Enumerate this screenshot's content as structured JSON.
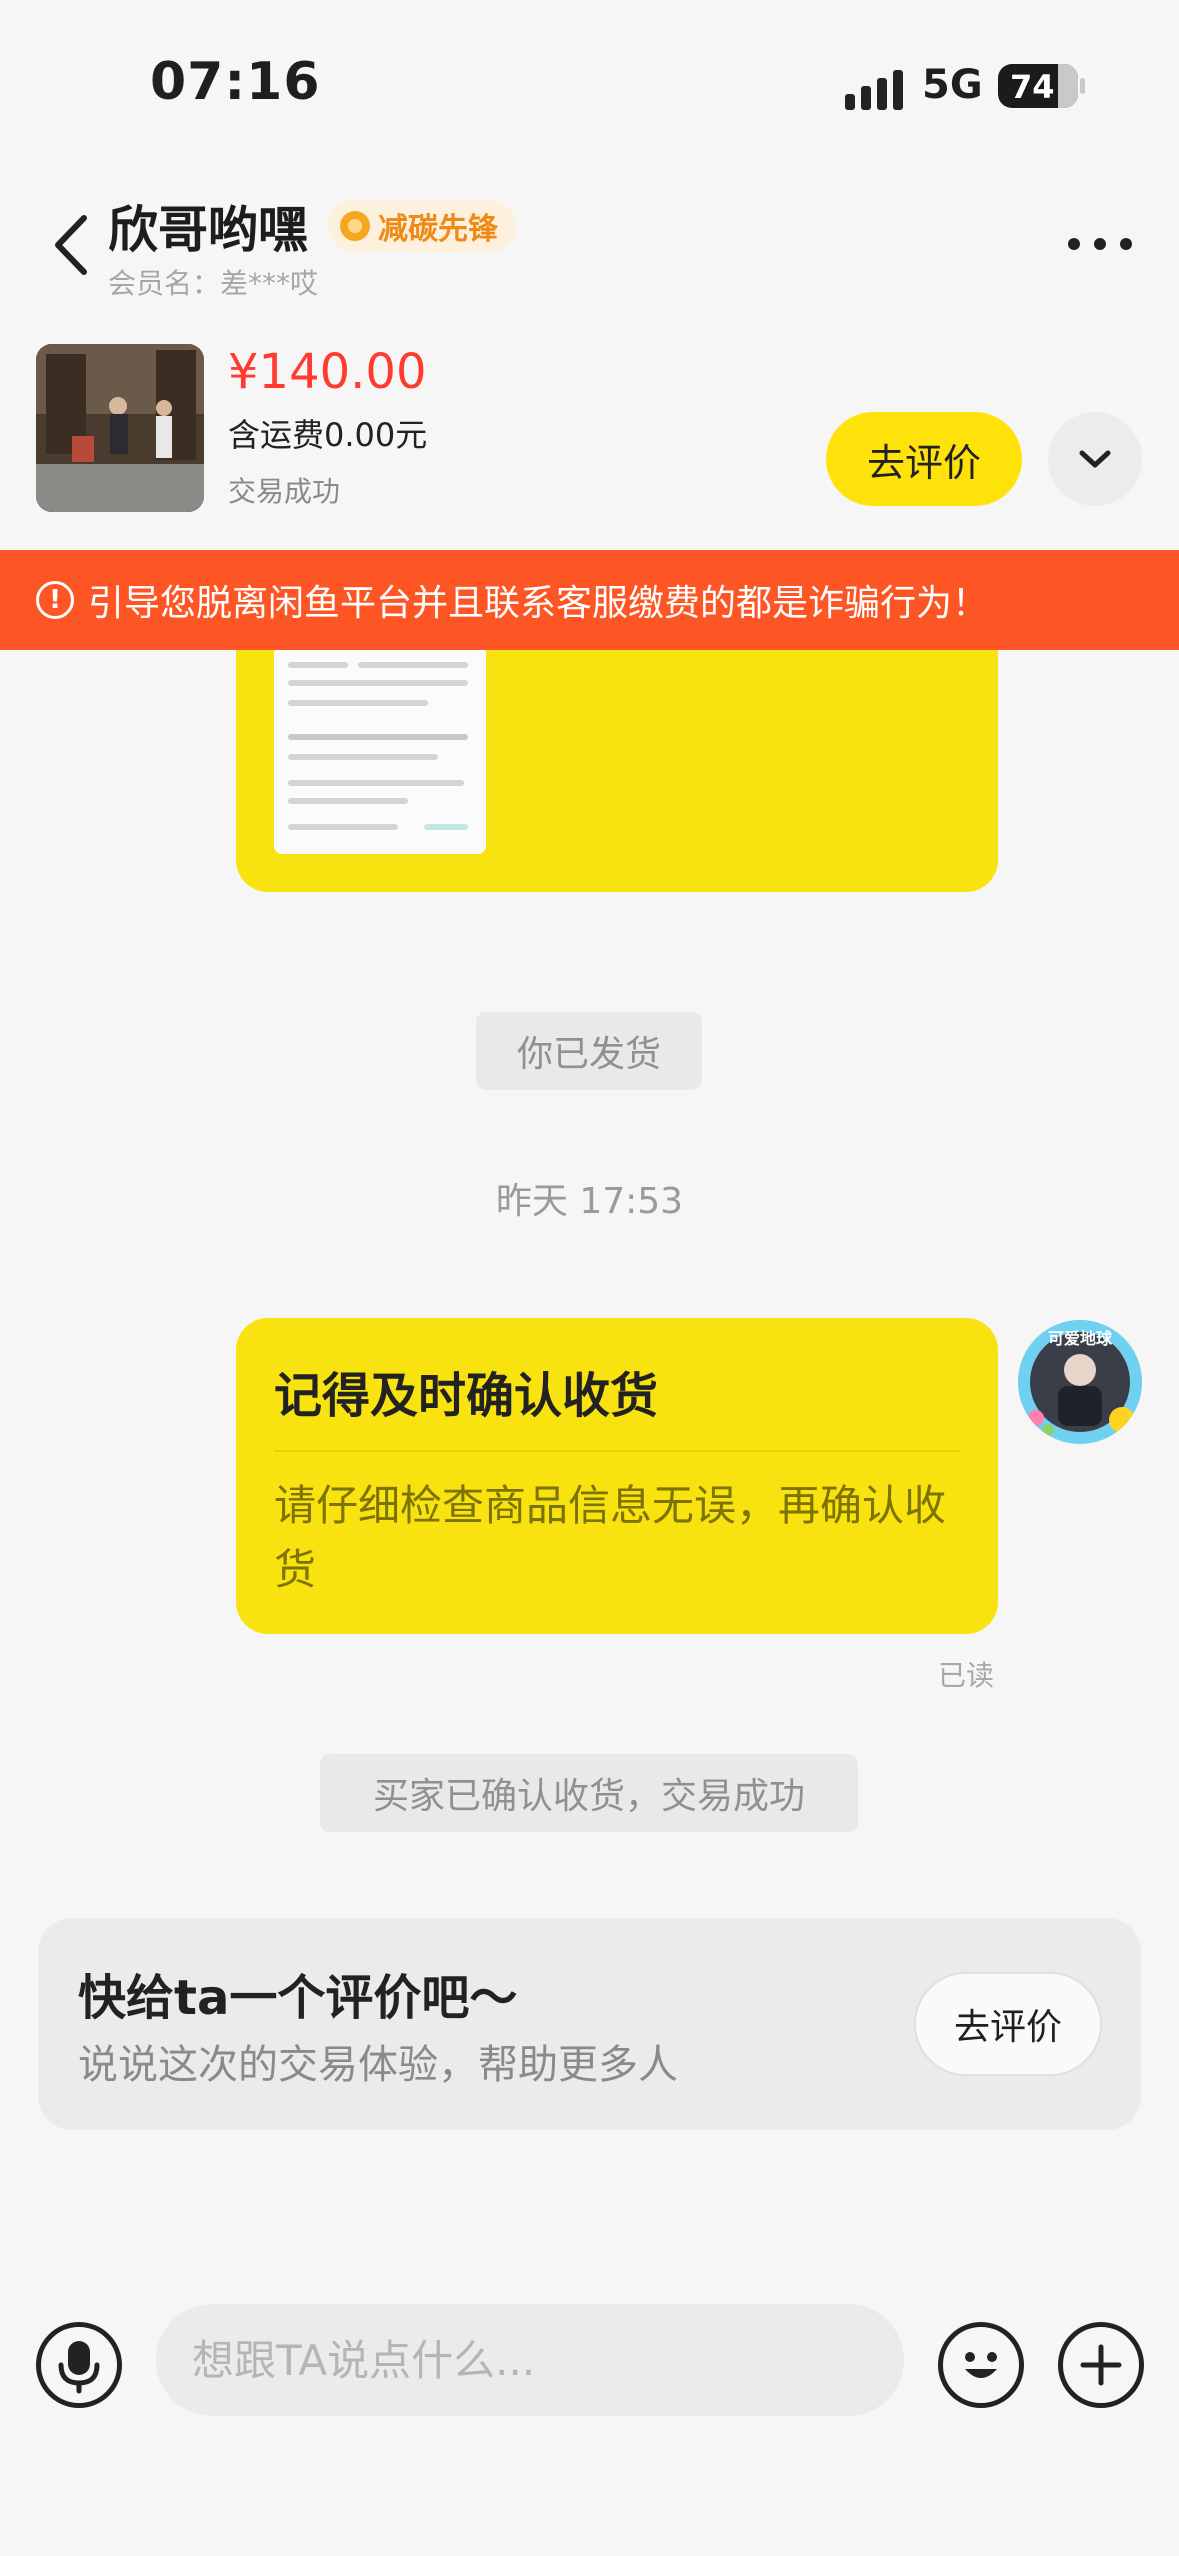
{
  "status_bar": {
    "time": "07:16",
    "network": "5G",
    "battery": "74"
  },
  "header": {
    "title": "欣哥哟嘿",
    "badge": "减碳先锋",
    "member": "会员名：差***哎"
  },
  "product": {
    "price": "¥140.00",
    "shipping": "含运费0.00元",
    "status": "交易成功",
    "review_button": "去评价"
  },
  "warning": {
    "icon": "!",
    "text": "引导您脱离闲鱼平台并且联系客服缴费的都是诈骗行为！"
  },
  "chat": {
    "system_shipped": "你已发货",
    "timestamp": "昨天 17:53",
    "card_title": "记得及时确认收货",
    "card_body": "请仔细检查商品信息无误，再确认收货",
    "avatar_text": "可爱地球",
    "read_status": "已读",
    "system_confirmed": "买家已确认收货，交易成功"
  },
  "review_card": {
    "title": "快给ta一个评价吧～",
    "subtitle": "说说这次的交易体验，帮助更多人",
    "button": "去评价"
  },
  "input_bar": {
    "placeholder": "想跟TA说点什么..."
  },
  "colors": {
    "accent_yellow": "#ffe20a",
    "bubble_yellow": "#f8e20f",
    "warning_orange": "#fe5524",
    "price_red": "#ff3b30"
  }
}
